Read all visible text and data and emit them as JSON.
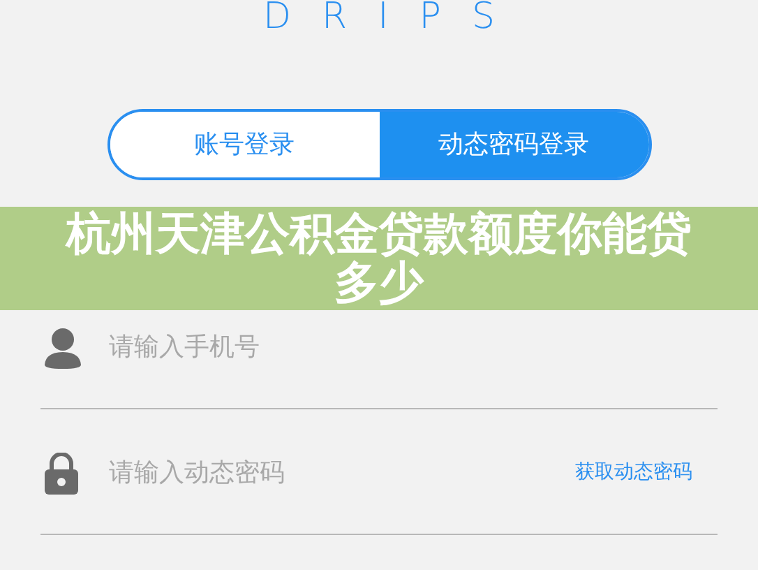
{
  "logo": {
    "text": "DRIPS"
  },
  "tabs": [
    {
      "label": "账号登录",
      "selected": false
    },
    {
      "label": "动态密码登录",
      "selected": true
    }
  ],
  "fields": [
    {
      "kind": "phone",
      "placeholder": "请输入手机号"
    },
    {
      "kind": "password",
      "placeholder": "请输入动态密码",
      "action": "获取动态密码"
    }
  ],
  "banner": {
    "title": "杭州天津公积金贷款额度你能贷多少"
  }
}
